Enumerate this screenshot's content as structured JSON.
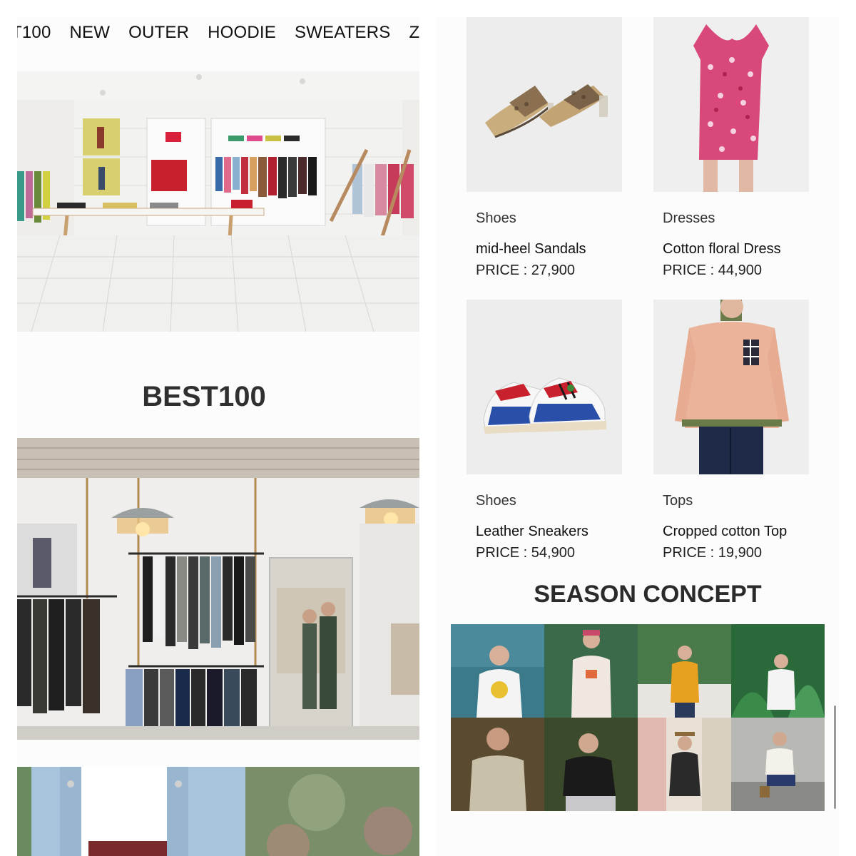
{
  "nav": {
    "items": [
      "T100",
      "NEW",
      "OUTER",
      "HOODIE",
      "SWEATERS",
      "Z"
    ]
  },
  "best": {
    "title": "BEST100"
  },
  "products": [
    {
      "category": "Shoes",
      "name": "mid-heel Sandals",
      "price": "PRICE : 27,900"
    },
    {
      "category": "Dresses",
      "name": "Cotton floral Dress",
      "price": "PRICE : 44,900"
    },
    {
      "category": "Shoes",
      "name": "Leather Sneakers",
      "price": "PRICE : 54,900"
    },
    {
      "category": "Tops",
      "name": "Cropped cotton Top",
      "price": "PRICE : 19,900"
    }
  ],
  "season": {
    "title": "SEASON CONCEPT"
  },
  "colors": {
    "background": "#ffffff",
    "panel": "#fcfcfc",
    "thumb": "#ededed",
    "text": "#2a2a2a"
  }
}
